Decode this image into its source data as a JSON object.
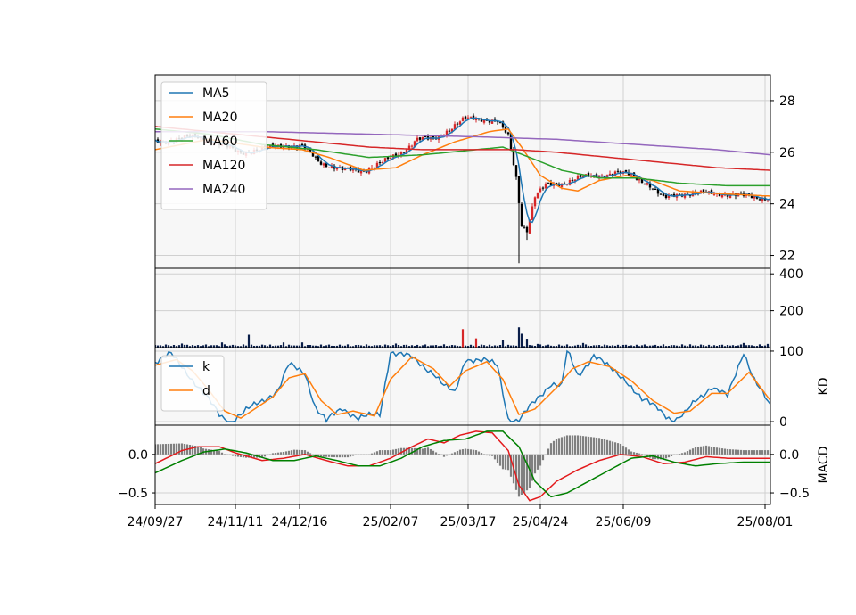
{
  "colors": {
    "ma5": "#1f77b4",
    "ma20": "#ff7f0e",
    "ma60": "#2ca02c",
    "ma120": "#d62728",
    "ma240": "#9467bd",
    "candle_up": "#d62728",
    "candle_down": "#000000",
    "volume_bar": "#0b1f4a",
    "macd_bar": "#808080",
    "dif": "#e31a1c",
    "dea": "#008000",
    "panel_bg": "#f7f7f7",
    "grid": "#d0d0d0"
  },
  "chart_data": {
    "type": "line",
    "x_ticks": [
      "24/09/27",
      "24/11/11",
      "24/12/16",
      "25/02/07",
      "25/03/17",
      "25/04/24",
      "25/06/09",
      "25/08/01"
    ],
    "x_tick_index": [
      0,
      30,
      54,
      88,
      117,
      144,
      175,
      228
    ],
    "n_points": 231,
    "panels": {
      "price": {
        "y_ticks": [
          "22",
          "24",
          "26",
          "28"
        ],
        "ylim": [
          21.5,
          29.0
        ],
        "legend": [
          "MA5",
          "MA20",
          "MA60",
          "MA120",
          "MA240"
        ],
        "legend_position": "upper-left",
        "close_anchors": [
          [
            0,
            26.4
          ],
          [
            8,
            26.5
          ],
          [
            16,
            26.6
          ],
          [
            24,
            26.3
          ],
          [
            32,
            26.0
          ],
          [
            40,
            26.1
          ],
          [
            48,
            26.3
          ],
          [
            55,
            26.2
          ],
          [
            62,
            25.6
          ],
          [
            70,
            25.3
          ],
          [
            78,
            25.3
          ],
          [
            85,
            25.6
          ],
          [
            92,
            26.0
          ],
          [
            98,
            26.5
          ],
          [
            104,
            26.5
          ],
          [
            110,
            26.9
          ],
          [
            116,
            27.3
          ],
          [
            122,
            27.3
          ],
          [
            128,
            27.2
          ],
          [
            132,
            26.6
          ],
          [
            135,
            25.0
          ],
          [
            137,
            23.2
          ],
          [
            139,
            23.0
          ],
          [
            142,
            24.3
          ],
          [
            146,
            24.7
          ],
          [
            152,
            24.8
          ],
          [
            158,
            25.0
          ],
          [
            166,
            25.1
          ],
          [
            172,
            25.2
          ],
          [
            178,
            25.1
          ],
          [
            184,
            24.8
          ],
          [
            190,
            24.2
          ],
          [
            196,
            24.4
          ],
          [
            204,
            24.4
          ],
          [
            212,
            24.4
          ],
          [
            220,
            24.3
          ],
          [
            230,
            24.2
          ]
        ],
        "ma20_anchors": [
          [
            0,
            26.1
          ],
          [
            20,
            26.5
          ],
          [
            40,
            26.2
          ],
          [
            55,
            26.1
          ],
          [
            65,
            25.8
          ],
          [
            78,
            25.3
          ],
          [
            90,
            25.4
          ],
          [
            100,
            25.9
          ],
          [
            112,
            26.4
          ],
          [
            125,
            26.8
          ],
          [
            132,
            26.9
          ],
          [
            137,
            26.2
          ],
          [
            144,
            25.1
          ],
          [
            152,
            24.6
          ],
          [
            158,
            24.5
          ],
          [
            166,
            24.9
          ],
          [
            176,
            25.1
          ],
          [
            186,
            24.9
          ],
          [
            196,
            24.5
          ],
          [
            210,
            24.4
          ],
          [
            230,
            24.3
          ]
        ],
        "ma60_anchors": [
          [
            0,
            26.9
          ],
          [
            20,
            26.7
          ],
          [
            40,
            26.3
          ],
          [
            60,
            26.1
          ],
          [
            80,
            25.8
          ],
          [
            100,
            25.9
          ],
          [
            120,
            26.1
          ],
          [
            130,
            26.2
          ],
          [
            140,
            25.8
          ],
          [
            152,
            25.3
          ],
          [
            166,
            25.0
          ],
          [
            180,
            25.0
          ],
          [
            196,
            24.8
          ],
          [
            214,
            24.7
          ],
          [
            230,
            24.7
          ]
        ],
        "ma120_anchors": [
          [
            0,
            27.0
          ],
          [
            20,
            26.8
          ],
          [
            40,
            26.6
          ],
          [
            60,
            26.4
          ],
          [
            80,
            26.2
          ],
          [
            100,
            26.1
          ],
          [
            120,
            26.1
          ],
          [
            135,
            26.1
          ],
          [
            150,
            26.0
          ],
          [
            170,
            25.8
          ],
          [
            190,
            25.6
          ],
          [
            210,
            25.4
          ],
          [
            230,
            25.3
          ]
        ],
        "ma240_anchors": [
          [
            0,
            26.8
          ],
          [
            40,
            26.8
          ],
          [
            80,
            26.7
          ],
          [
            120,
            26.6
          ],
          [
            150,
            26.5
          ],
          [
            180,
            26.3
          ],
          [
            210,
            26.1
          ],
          [
            230,
            25.9
          ]
        ],
        "crash_low": [
          [
            136,
            21.7
          ],
          [
            139,
            22.6
          ]
        ]
      },
      "volume": {
        "y_ticks": [
          "200",
          "400"
        ],
        "ylim": [
          0,
          430
        ],
        "spikes": [
          [
            10,
            22
          ],
          [
            25,
            28
          ],
          [
            35,
            70
          ],
          [
            48,
            28
          ],
          [
            55,
            28
          ],
          [
            75,
            14
          ],
          [
            90,
            22
          ],
          [
            115,
            100
          ],
          [
            120,
            50
          ],
          [
            130,
            40
          ],
          [
            136,
            110
          ],
          [
            137,
            75
          ],
          [
            139,
            48
          ],
          [
            143,
            20
          ],
          [
            160,
            25
          ],
          [
            200,
            18
          ],
          [
            220,
            25
          ],
          [
            229,
            20
          ]
        ],
        "base": 8
      },
      "kd": {
        "y_ticks": [
          "0",
          "100"
        ],
        "ylim": [
          -5,
          105
        ],
        "ylabel": "KD",
        "legend": [
          "k",
          "d"
        ],
        "legend_position": "upper-left",
        "k_anchors": [
          [
            0,
            85
          ],
          [
            6,
            95
          ],
          [
            12,
            70
          ],
          [
            18,
            40
          ],
          [
            24,
            10
          ],
          [
            28,
            0
          ],
          [
            34,
            15
          ],
          [
            40,
            30
          ],
          [
            46,
            45
          ],
          [
            50,
            80
          ],
          [
            56,
            70
          ],
          [
            60,
            20
          ],
          [
            64,
            0
          ],
          [
            70,
            20
          ],
          [
            76,
            5
          ],
          [
            84,
            10
          ],
          [
            88,
            100
          ],
          [
            96,
            90
          ],
          [
            104,
            70
          ],
          [
            108,
            50
          ],
          [
            112,
            40
          ],
          [
            116,
            90
          ],
          [
            124,
            85
          ],
          [
            128,
            80
          ],
          [
            132,
            5
          ],
          [
            136,
            0
          ],
          [
            140,
            20
          ],
          [
            148,
            55
          ],
          [
            152,
            50
          ],
          [
            154,
            100
          ],
          [
            158,
            65
          ],
          [
            164,
            95
          ],
          [
            170,
            75
          ],
          [
            176,
            60
          ],
          [
            182,
            30
          ],
          [
            188,
            20
          ],
          [
            194,
            0
          ],
          [
            198,
            10
          ],
          [
            202,
            30
          ],
          [
            208,
            50
          ],
          [
            214,
            35
          ],
          [
            220,
            100
          ],
          [
            224,
            60
          ],
          [
            230,
            20
          ]
        ],
        "d_anchors": [
          [
            0,
            80
          ],
          [
            8,
            88
          ],
          [
            14,
            72
          ],
          [
            20,
            45
          ],
          [
            26,
            15
          ],
          [
            32,
            5
          ],
          [
            38,
            20
          ],
          [
            44,
            35
          ],
          [
            50,
            62
          ],
          [
            56,
            68
          ],
          [
            62,
            30
          ],
          [
            68,
            10
          ],
          [
            74,
            15
          ],
          [
            82,
            8
          ],
          [
            88,
            60
          ],
          [
            96,
            92
          ],
          [
            104,
            75
          ],
          [
            110,
            50
          ],
          [
            116,
            72
          ],
          [
            124,
            85
          ],
          [
            130,
            60
          ],
          [
            136,
            10
          ],
          [
            142,
            18
          ],
          [
            150,
            48
          ],
          [
            156,
            75
          ],
          [
            162,
            85
          ],
          [
            170,
            78
          ],
          [
            178,
            58
          ],
          [
            186,
            30
          ],
          [
            194,
            12
          ],
          [
            200,
            15
          ],
          [
            208,
            40
          ],
          [
            214,
            40
          ],
          [
            222,
            70
          ],
          [
            230,
            30
          ]
        ]
      },
      "macd": {
        "y_ticks": [
          "0.0",
          "−0.5"
        ],
        "ylim": [
          -0.65,
          0.38
        ],
        "ylabel": "MACD",
        "dif_anchors": [
          [
            0,
            -0.12
          ],
          [
            10,
            0.05
          ],
          [
            16,
            0.1
          ],
          [
            24,
            0.1
          ],
          [
            30,
            0.02
          ],
          [
            40,
            -0.08
          ],
          [
            48,
            -0.05
          ],
          [
            56,
            0.0
          ],
          [
            64,
            -0.08
          ],
          [
            72,
            -0.15
          ],
          [
            80,
            -0.15
          ],
          [
            88,
            -0.05
          ],
          [
            96,
            0.1
          ],
          [
            102,
            0.2
          ],
          [
            108,
            0.15
          ],
          [
            114,
            0.25
          ],
          [
            120,
            0.3
          ],
          [
            126,
            0.28
          ],
          [
            132,
            0.05
          ],
          [
            136,
            -0.4
          ],
          [
            140,
            -0.6
          ],
          [
            144,
            -0.55
          ],
          [
            150,
            -0.35
          ],
          [
            158,
            -0.2
          ],
          [
            166,
            -0.08
          ],
          [
            174,
            0.0
          ],
          [
            182,
            -0.03
          ],
          [
            190,
            -0.12
          ],
          [
            198,
            -0.1
          ],
          [
            206,
            -0.03
          ],
          [
            214,
            -0.05
          ],
          [
            222,
            -0.05
          ],
          [
            230,
            -0.05
          ]
        ],
        "dea_anchors": [
          [
            0,
            -0.24
          ],
          [
            10,
            -0.08
          ],
          [
            18,
            0.03
          ],
          [
            26,
            0.07
          ],
          [
            34,
            0.02
          ],
          [
            44,
            -0.08
          ],
          [
            52,
            -0.08
          ],
          [
            60,
            -0.02
          ],
          [
            68,
            -0.08
          ],
          [
            76,
            -0.15
          ],
          [
            84,
            -0.15
          ],
          [
            92,
            -0.05
          ],
          [
            100,
            0.1
          ],
          [
            108,
            0.18
          ],
          [
            116,
            0.2
          ],
          [
            124,
            0.3
          ],
          [
            130,
            0.3
          ],
          [
            136,
            0.1
          ],
          [
            142,
            -0.35
          ],
          [
            148,
            -0.55
          ],
          [
            154,
            -0.5
          ],
          [
            162,
            -0.35
          ],
          [
            170,
            -0.2
          ],
          [
            178,
            -0.05
          ],
          [
            186,
            -0.02
          ],
          [
            194,
            -0.1
          ],
          [
            202,
            -0.15
          ],
          [
            210,
            -0.12
          ],
          [
            220,
            -0.1
          ],
          [
            230,
            -0.1
          ]
        ]
      }
    }
  }
}
